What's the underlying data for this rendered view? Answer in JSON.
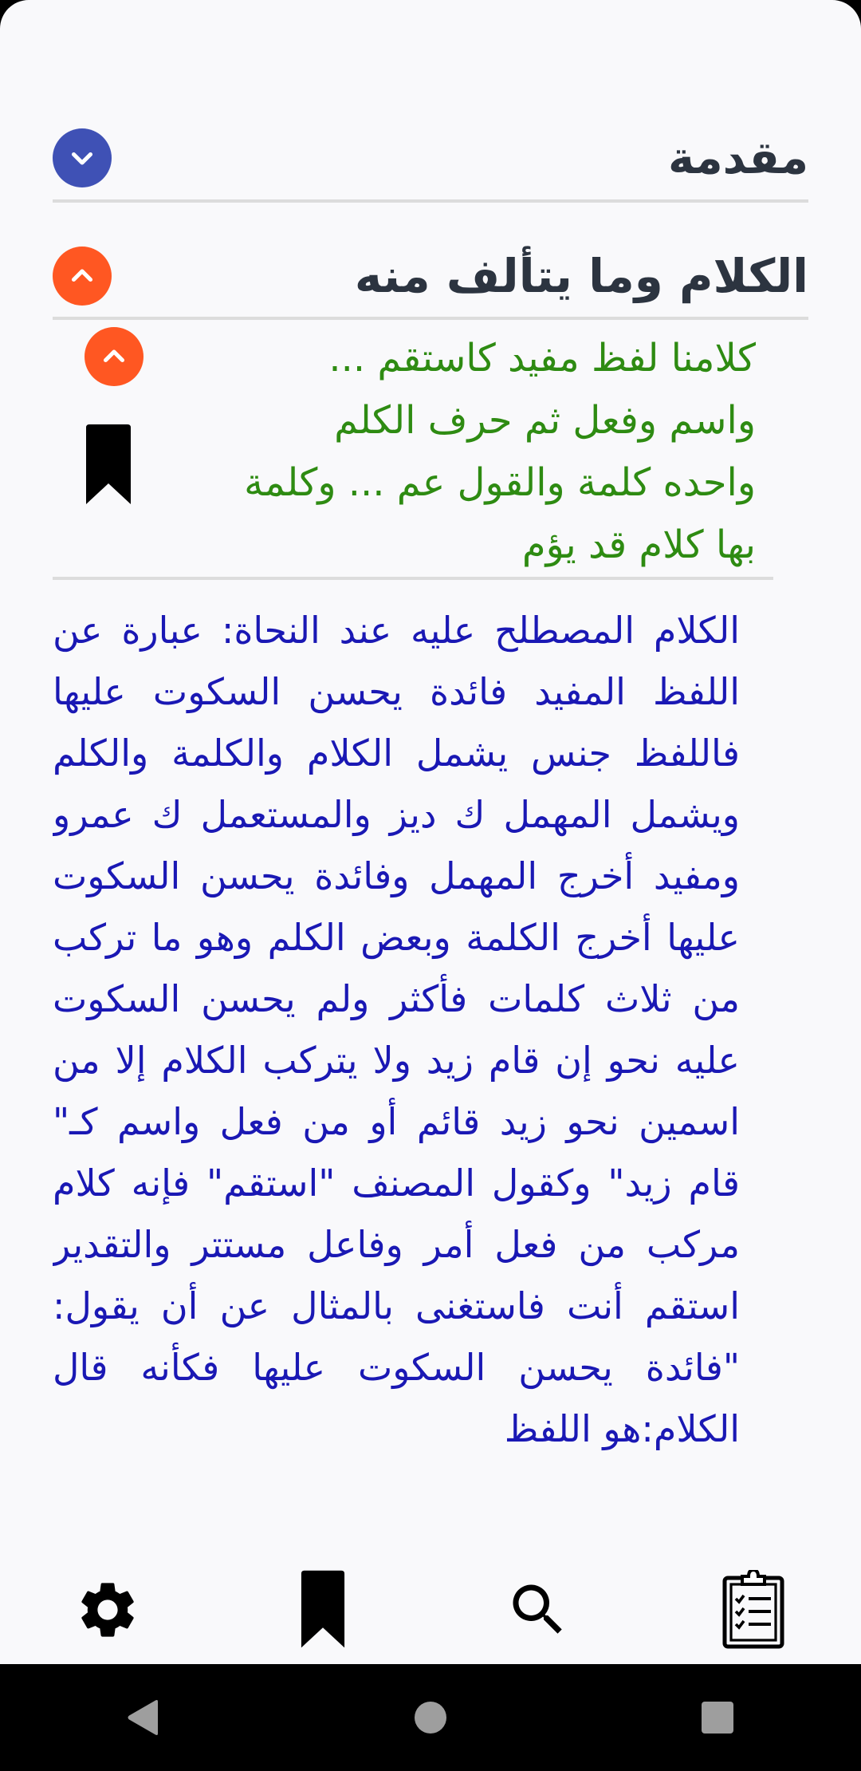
{
  "sections": {
    "intro": {
      "title": "مقدمة",
      "toggle_icon": "chevron-down-icon",
      "toggle_color": "#3f51b5"
    },
    "chapter": {
      "title": "الكلام وما يتألف منه",
      "toggle_icon": "chevron-up-icon",
      "toggle_color": "#ff5722"
    }
  },
  "verse": {
    "lines": [
      "كلامنا لفظ مفيد كاستقم ...",
      "واسم وفعل ثم حرف الكلم",
      "واحده كلمة والقول عم ... وكلمة",
      "بها كلام قد يؤم"
    ],
    "collapse_icon": "chevron-up-icon",
    "bookmark_icon": "bookmark-icon",
    "color": "#2e8b12"
  },
  "commentary": {
    "text": "الكلام المصطلح عليه عند النحاة: عبارة عن اللفظ المفيد فائدة يحسن السكوت عليها فاللفظ جنس يشمل الكلام والكلمة والكلم ويشمل المهمل ك ديز والمستعمل ك عمرو ومفيد أخرج المهمل وفائدة يحسن السكوت عليها أخرج الكلمة وبعض الكلم وهو ما تركب من ثلاث كلمات فأكثر ولم يحسن السكوت عليه نحو إن قام زيد ولا يتركب الكلام إلا من اسمين نحو زيد قائم أو من فعل واسم كـ\" قام زيد\" وكقول المصنف \"استقم\" فإنه كلام مركب من فعل أمر وفاعل مستتر والتقدير استقم أنت فاستغنى بالمثال عن أن يقول: \"فائدة يحسن السكوت عليها فكأنه قال الكلام:هو اللفظ",
    "color": "#1a18b4"
  },
  "bottom_nav": [
    {
      "icon": "gear-icon"
    },
    {
      "icon": "bookmark-icon"
    },
    {
      "icon": "search-icon"
    },
    {
      "icon": "clipboard-checklist-icon"
    }
  ],
  "system_nav": [
    {
      "icon": "back-triangle-icon"
    },
    {
      "icon": "home-circle-icon"
    },
    {
      "icon": "recents-square-icon"
    }
  ]
}
